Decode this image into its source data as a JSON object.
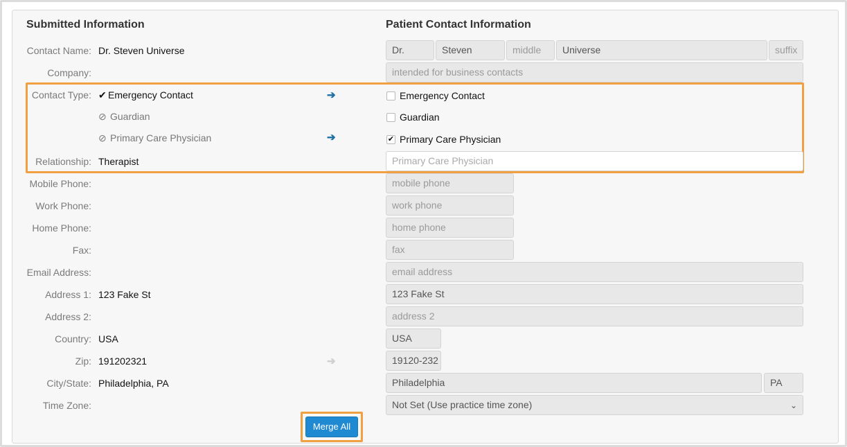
{
  "headings": {
    "submitted": "Submitted Information",
    "patient": "Patient Contact Information"
  },
  "submitted": {
    "contact_name": {
      "label": "Contact Name:",
      "value": "Dr. Steven Universe"
    },
    "company": {
      "label": "Company:",
      "value": ""
    },
    "contact_type": {
      "label": "Contact Type:",
      "items": [
        {
          "icon": "check-icon",
          "glyph": "✔",
          "text": "Emergency Contact"
        },
        {
          "icon": "prohibited-icon",
          "glyph": "⊘",
          "text": "Guardian"
        },
        {
          "icon": "prohibited-icon",
          "glyph": "⊘",
          "text": "Primary Care Physician"
        }
      ]
    },
    "relationship": {
      "label": "Relationship:",
      "value": "Therapist"
    },
    "mobile_phone": {
      "label": "Mobile Phone:",
      "value": ""
    },
    "work_phone": {
      "label": "Work Phone:",
      "value": ""
    },
    "home_phone": {
      "label": "Home Phone:",
      "value": ""
    },
    "fax": {
      "label": "Fax:",
      "value": ""
    },
    "email": {
      "label": "Email Address:",
      "value": ""
    },
    "address1": {
      "label": "Address 1:",
      "value": "123 Fake St"
    },
    "address2": {
      "label": "Address 2:",
      "value": ""
    },
    "country": {
      "label": "Country:",
      "value": "USA"
    },
    "zip": {
      "label": "Zip:",
      "value": "191202321"
    },
    "city_state": {
      "label": "City/State:",
      "value": "Philadelphia, PA"
    },
    "time_zone": {
      "label": "Time Zone:",
      "value": ""
    }
  },
  "arrows": {
    "glyph": "➔",
    "icon": "arrow-right-icon"
  },
  "patient": {
    "prefix": "Dr.",
    "first": "Steven",
    "middle_placeholder": "middle",
    "last": "Universe",
    "suffix_placeholder": "suffix",
    "company_placeholder": "intended for business contacts",
    "contact_types": [
      {
        "label": "Emergency Contact",
        "checked": false
      },
      {
        "label": "Guardian",
        "checked": false
      },
      {
        "label": "Primary Care Physician",
        "checked": true
      }
    ],
    "check_glyph": "✔",
    "relationship_placeholder": "Primary Care Physician",
    "mobile_placeholder": "mobile phone",
    "work_placeholder": "work phone",
    "home_placeholder": "home phone",
    "fax_placeholder": "fax",
    "email_placeholder": "email address",
    "address1": "123 Fake St",
    "address2_placeholder": "address 2",
    "country": "USA",
    "zip": "19120-232",
    "city": "Philadelphia",
    "state": "PA",
    "time_zone": "Not Set (Use practice time zone)",
    "caret_glyph": "⌄"
  },
  "merge_all_label": "Merge All",
  "colors": {
    "highlight": "#f0a040",
    "button": "#1f8ad2",
    "arrow": "#1f6fa3"
  }
}
